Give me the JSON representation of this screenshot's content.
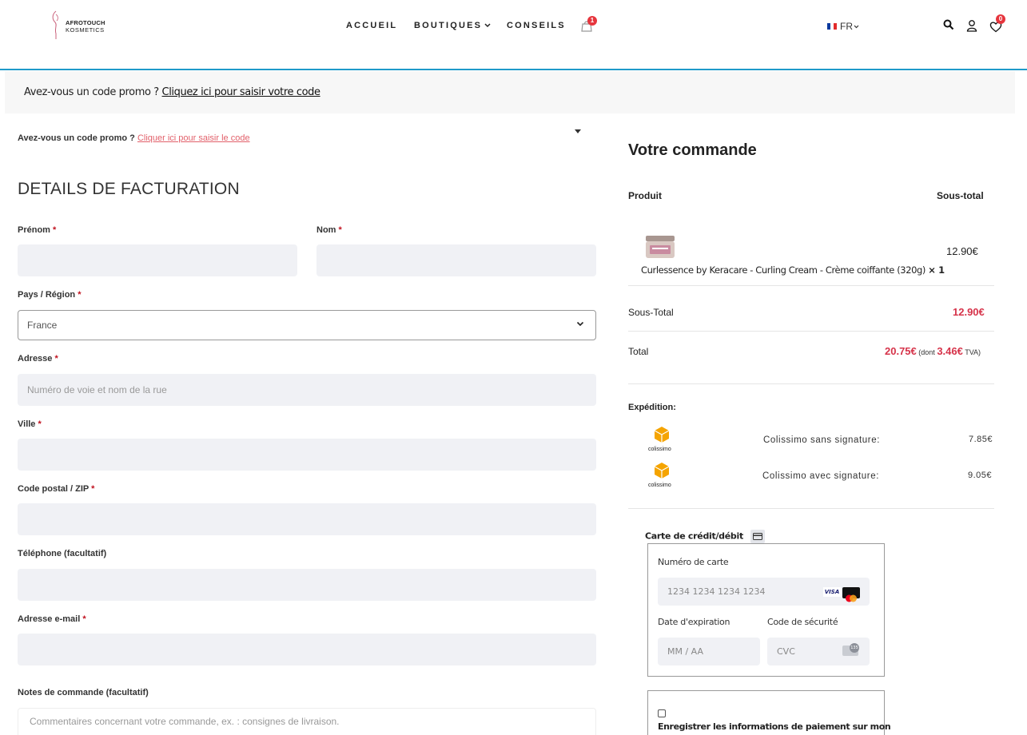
{
  "header": {
    "logo_line1": "AFROTOUCH",
    "logo_line2": "KOSMETICS",
    "nav": {
      "home": "ACCUEIL",
      "shops": "BOUTIQUES",
      "tips": "CONSEILS"
    },
    "cart_badge": "1",
    "language": "FR",
    "wishlist_badge": "0"
  },
  "promo_bar": {
    "question": "Avez-vous un code promo ?",
    "link": "Cliquez ici pour saisir votre code"
  },
  "promo_secondary": {
    "question": "Avez-vous un code promo ?",
    "link": "Cliquer ici pour saisir le code"
  },
  "billing": {
    "title": "DETAILS DE FACTURATION",
    "first_name_label": "Prénom",
    "last_name_label": "Nom",
    "country_label": "Pays / Région",
    "country_value": "France",
    "address_label": "Adresse",
    "address_placeholder": "Numéro de voie et nom de la rue",
    "city_label": "Ville",
    "postcode_label": "Code postal / ZIP",
    "phone_label": "Téléphone (facultatif)",
    "email_label": "Adresse e-mail",
    "required_mark": "*",
    "notes_label": "Notes de commande (facultatif)",
    "notes_placeholder": "Commentaires concernant votre commande, ex. : consignes de livraison."
  },
  "order": {
    "title": "Votre commande",
    "col_product": "Produit",
    "col_subtotal": "Sous-total",
    "item_name": "Curlessence by Keracare - Curling Cream - Crème coiffante (320g)",
    "item_qty": "× 1",
    "item_price": "12.90€",
    "subtotal_label": "Sous-Total",
    "subtotal_value": "12.90€",
    "total_label": "Total",
    "total_value": "20.75€",
    "tax_prefix": "(dont",
    "tax_value": "3.46€",
    "tax_suffix": "TVA)",
    "shipping_label": "Expédition:",
    "shipping_options": [
      {
        "name": "Colissimo sans signature:",
        "price": "7.85€",
        "logo_text": "colissimo"
      },
      {
        "name": "Colissimo avec signature:",
        "price": "9.05€",
        "logo_text": "colissimo"
      }
    ]
  },
  "payment": {
    "method_label": "Carte de crédit/débit",
    "card_number_label": "Numéro de carte",
    "card_number_placeholder": "1234 1234 1234 1234",
    "visa_text": "VISA",
    "expiry_label": "Date d'expiration",
    "expiry_placeholder": "MM / AA",
    "cvc_label": "Code de sécurité",
    "cvc_placeholder": "CVC",
    "cvc_icon_text": "135",
    "save_label": "Enregistrer les informations de paiement sur mon"
  },
  "colors": {
    "accent_blue": "#1f9ac9",
    "price_pink": "#d6334a",
    "link_pink": "#e2616b",
    "badge_red": "#e6353d",
    "input_bg": "#f0f1f5",
    "colissimo_orange": "#f5a400"
  }
}
